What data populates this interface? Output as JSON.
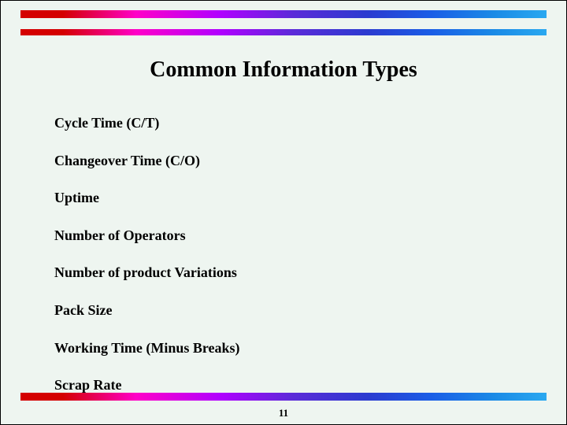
{
  "title": "Common Information Types",
  "items": [
    "Cycle Time (C/T)",
    "Changeover Time (C/O)",
    "Uptime",
    "Number of Operators",
    "Number of product Variations",
    "Pack Size",
    "Working Time (Minus Breaks)",
    "Scrap Rate"
  ],
  "page_number": "11"
}
